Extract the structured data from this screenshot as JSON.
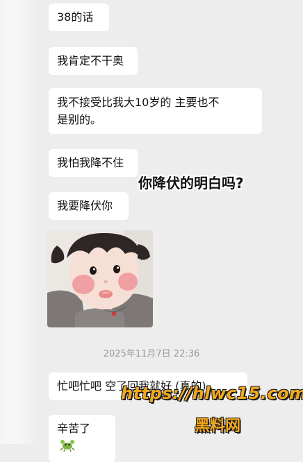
{
  "messages": [
    {
      "text": "38的话"
    },
    {
      "text": "我肯定不干奥"
    },
    {
      "text_line1": "我不接受比我大10岁的 主要也不",
      "text_line2": "是别的。"
    },
    {
      "text": "我怕我降不住"
    },
    {
      "text": "我要降伏你"
    },
    {
      "image": "child-photo"
    },
    {
      "text": "忙吧忙吧 空了回我就好 (真的)"
    },
    {
      "text": "辛苦了",
      "icon": "crab-emoji-icon"
    }
  ],
  "overlay_caption": "你降伏的明白吗?",
  "timestamp": "2025年11月7日 22:36",
  "watermark": {
    "url": "https://hlwc15.com",
    "name": "黑料网"
  },
  "colors": {
    "background": "#ededed",
    "bubble": "#ffffff",
    "watermark": "#f2a81d"
  }
}
